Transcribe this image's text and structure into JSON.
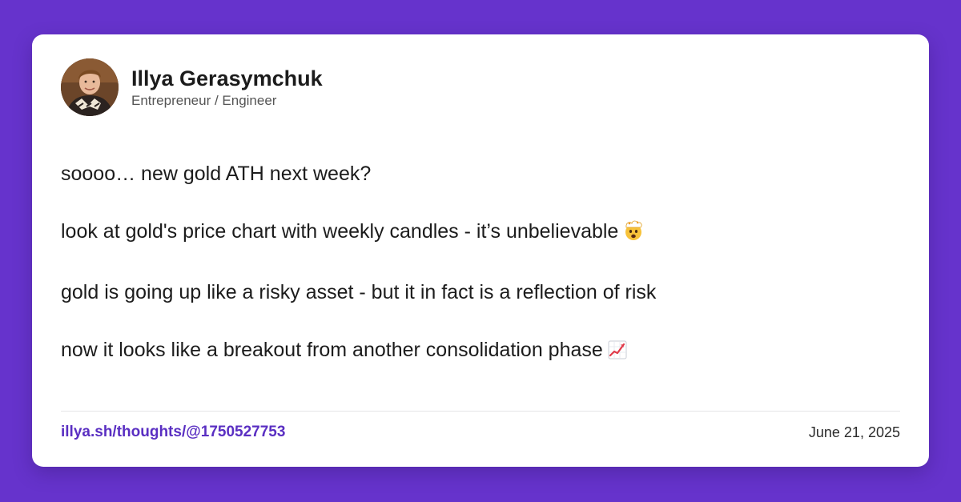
{
  "author": {
    "name": "Illya Gerasymchuk",
    "role": "Entrepreneur / Engineer"
  },
  "post": {
    "lines": [
      "soooo… new gold ATH next week?",
      "look at gold's price chart with weekly candles - it’s unbelievable",
      "gold is going up like a risky asset - but it in fact is a reflection of risk",
      "now it looks like a breakout from another consolidation phase"
    ],
    "emojis": [
      "exploding-head-icon",
      "chart-increasing-icon"
    ]
  },
  "footer": {
    "permalink": "illya.sh/thoughts/@1750527753",
    "date": "June 21, 2025"
  },
  "colors": {
    "background": "#6633cc",
    "card": "#ffffff",
    "link": "#5a2fc2",
    "text": "#1c1c1c"
  }
}
